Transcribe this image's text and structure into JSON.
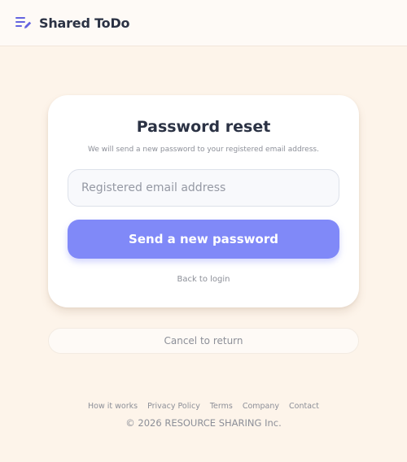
{
  "header": {
    "logo_icon": "list-edit-icon",
    "title": "Shared ToDo",
    "accent_color": "#6464e0"
  },
  "card": {
    "title": "Password reset",
    "subtitle": "We will send a new password to your registered email address.",
    "email_input": {
      "value": "",
      "placeholder": "Registered email address"
    },
    "send_button_label": "Send a new password",
    "back_link_label": "Back to login"
  },
  "cancel_button_label": "Cancel to return",
  "footer": {
    "links": [
      "How it works",
      "Privacy Policy",
      "Terms",
      "Company",
      "Contact"
    ],
    "copyright": "© 2026 RESOURCE SHARING Inc."
  },
  "colors": {
    "page_background": "#fdf4ea",
    "primary_button": "#8089f8",
    "text_dark": "#2b3244",
    "text_muted": "#8c8f98"
  }
}
